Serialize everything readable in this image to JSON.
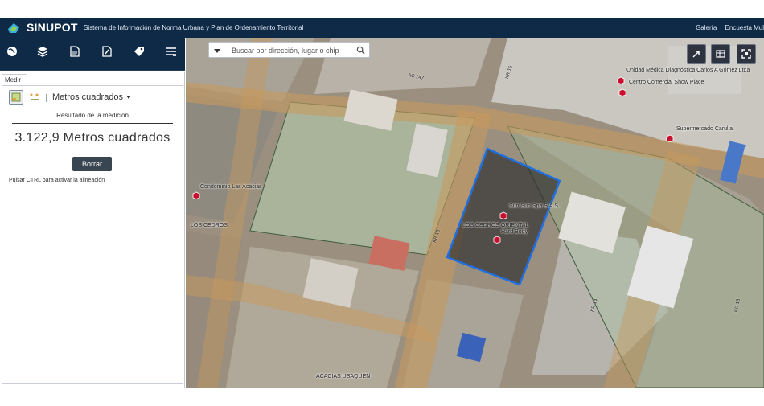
{
  "header": {
    "brand": "SINUPOT",
    "subtitle": "Sistema de Información de Norma Urbana y Plan de Ordenamiento Territorial",
    "links": [
      "Galería",
      "Encuesta Mul"
    ]
  },
  "toolbar": {
    "icons": [
      "globe-icon",
      "layers-icon",
      "document-icon",
      "document-edit-icon",
      "tag-icon",
      "menu-icon"
    ]
  },
  "panel": {
    "tab_label": "Medir",
    "units_label": "Metros cuadrados",
    "result_title": "Resultado de la medición",
    "result_value": "3.122,9 Metros cuadrados",
    "clear_label": "Borrar",
    "hint": "Pulsar CTRL para activar la alineación"
  },
  "map": {
    "search_placeholder": "Buscar por dirección, lugar o chip",
    "labels": {
      "unidad_medica": "Unidad Médica Diagnóstica Carlos A Gómez Ltda",
      "centro_comercial": "Centro Comercial Show Place",
      "supermercado": "Supermercado Carulla",
      "condominio": "Condominio Las Acacias",
      "los_cedros_1": "LOS CEDROS",
      "los_cedros_2": "LOS CEDROS ORIENTAL",
      "sun_spa": "Sun Sun Spa S.A.S.",
      "hard_body": "Hard Body",
      "acacias": "ACACIAS USAQUEN"
    },
    "streets": [
      "AC 147",
      "KR 15",
      "KR 16",
      "KR 14",
      "KR 13"
    ],
    "colors": {
      "selection_outline": "#1f6fe0",
      "header_bg": "#0e2a47",
      "marker": "#c8102e"
    }
  }
}
